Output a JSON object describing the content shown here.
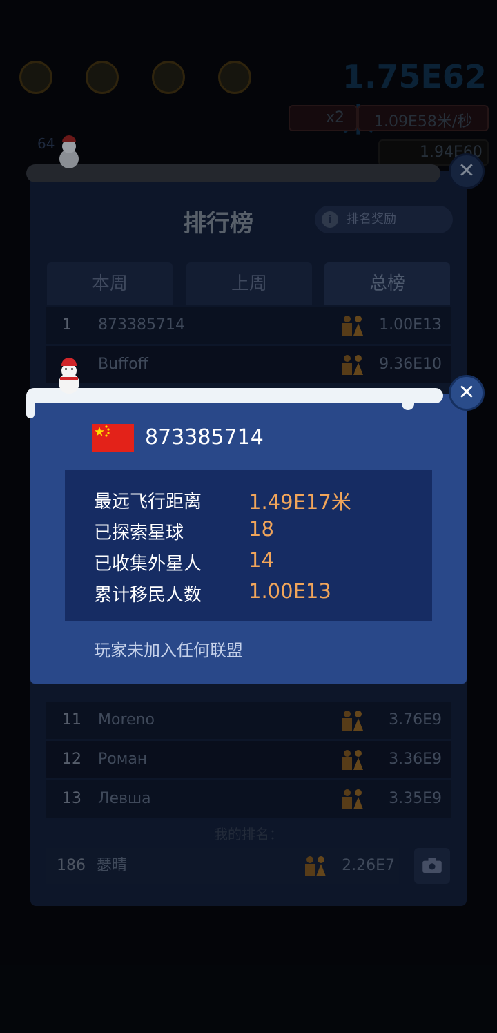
{
  "hud": {
    "distance": "1.75E62米",
    "boost": "x2",
    "rate": "1.09E58米/秒",
    "coins": "1.94E60",
    "level": "64"
  },
  "leaderboard": {
    "title": "排行榜",
    "reward_label": "排名奖励",
    "tabs": [
      "本周",
      "上周",
      "总榜"
    ],
    "active_tab": "总榜",
    "rows": [
      {
        "rank": "1",
        "name": "873385714",
        "value": "1.00E13"
      },
      {
        "rank": "",
        "name": "Buffoff",
        "value": "9.36E10"
      },
      {
        "rank": "11",
        "name": "Moreno",
        "value": "3.76E9"
      },
      {
        "rank": "12",
        "name": "Роман",
        "value": "3.36E9"
      },
      {
        "rank": "13",
        "name": "Левша",
        "value": "3.35E9"
      }
    ],
    "my_rank_label": "我的排名：",
    "my_rank": {
      "rank": "186",
      "name": "瑟晴",
      "value": "2.26E7"
    }
  },
  "player_popup": {
    "flag": "china-flag",
    "player_id": "873385714",
    "stats": [
      {
        "label": "最远飞行距离",
        "value": "1.49E17米"
      },
      {
        "label": "已探索星球",
        "value": "18"
      },
      {
        "label": "已收集外星人",
        "value": "14"
      },
      {
        "label": "累计移民人数",
        "value": "1.00E13"
      }
    ],
    "alliance_status": "玩家未加入任何联盟",
    "close_icon": "close-icon"
  },
  "colors": {
    "popup_bg": "#294889",
    "stats_bg": "#162c63",
    "value_orange": "#f1a55a",
    "panel_bg": "#111c33"
  }
}
